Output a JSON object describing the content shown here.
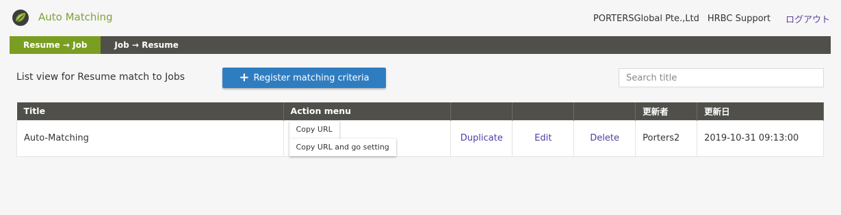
{
  "header": {
    "app_title": "Auto Matching",
    "logo_icon": "leaf-logo-icon",
    "company": "PORTERSGlobal Pte.,Ltd",
    "user": "HRBC Support",
    "logout": "ログアウト"
  },
  "nav": {
    "tabs": [
      {
        "label": "Resume → Job",
        "active": true
      },
      {
        "label": "Job → Resume",
        "active": false
      }
    ]
  },
  "toolbar": {
    "heading": "List view for Resume match to Jobs",
    "register_label": "Register matching criteria",
    "search_placeholder": "Search title"
  },
  "table": {
    "headers": [
      "Title",
      "Action menu",
      "",
      "",
      "",
      "更新者",
      "更新日"
    ],
    "rows": [
      {
        "title": "Auto-Matching",
        "copy_url": "Copy URL",
        "copy_url_setting": "Copy URL and go setting",
        "duplicate": "Duplicate",
        "edit": "Edit",
        "delete": "Delete",
        "updated_by": "Porters2",
        "updated_at": "2019-10-31 09:13:00"
      }
    ]
  },
  "colors": {
    "accent_green": "#7a9e22",
    "nav_dark": "#504f4a",
    "primary_blue": "#2f7dc1",
    "link_purple": "#4a3ea8"
  }
}
